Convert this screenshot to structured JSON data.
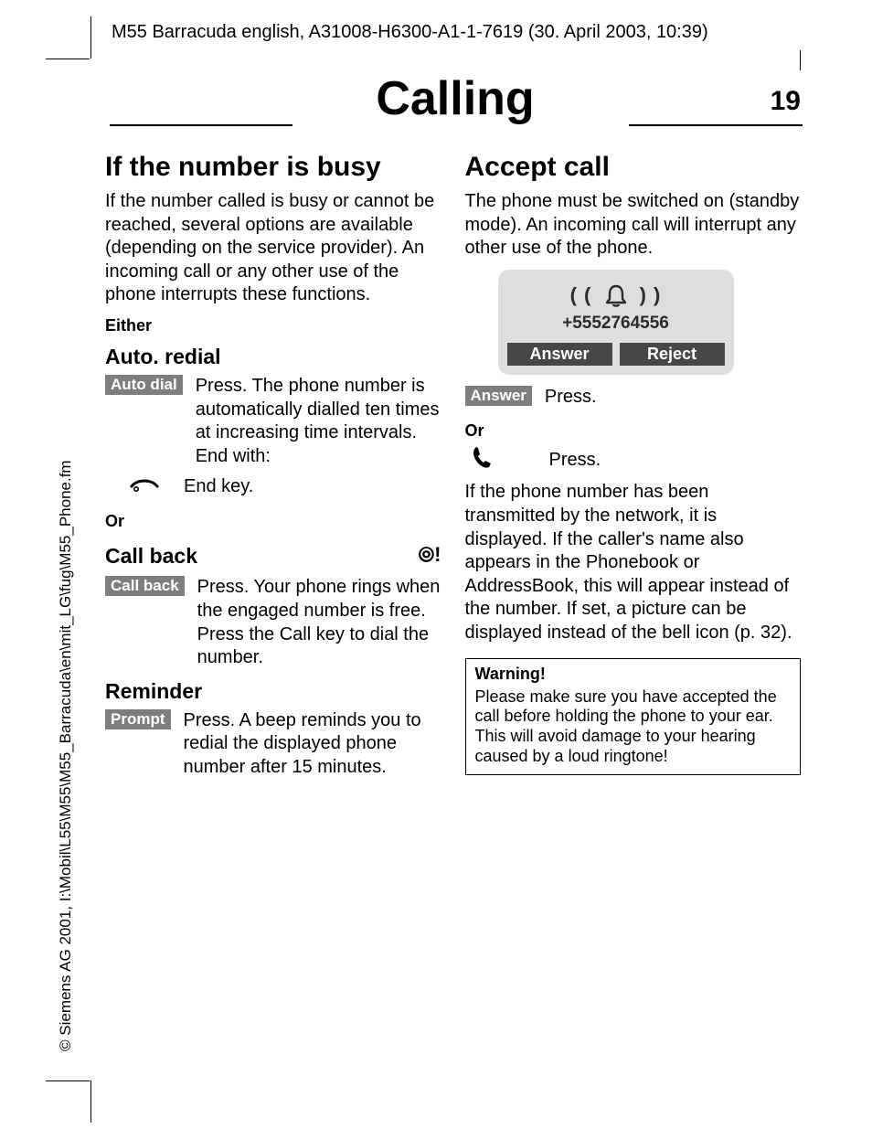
{
  "running_head": "M55 Barracuda english, A31008-H6300-A1-1-7619 (30. April 2003, 10:39)",
  "chapter_title": "Calling",
  "page_number": "19",
  "side_copyright": "© Siemens AG 2001, I:\\Mobil\\L55\\M55\\M55_Barracuda\\en\\mit_LG\\fug\\M55_Phone.fm",
  "left": {
    "h2": "If the number is busy",
    "intro": "If the number called is busy or cannot be reached, several options are available (depending on the service provider). An incoming call or any other use of the phone interrupts these functions.",
    "either": "Either",
    "auto_redial": {
      "heading": "Auto. redial",
      "badge": "Auto dial",
      "text": "Press. The phone number is automatically dialled ten times at increasing time intervals. End with:",
      "endkey": "End key."
    },
    "or1": "Or",
    "call_back": {
      "heading": "Call back",
      "svc_icon": "⦾!",
      "badge": "Call back",
      "text": "Press. Your phone rings when the engaged number is free. Press the Call key to dial the number."
    },
    "reminder": {
      "heading": "Reminder",
      "badge": "Prompt",
      "text": "Press. A beep reminds you to redial the displayed phone number after 15 minutes."
    }
  },
  "right": {
    "h2": "Accept call",
    "intro": "The phone must be switched on (standby mode). An incoming call will interrupt any other use of the phone.",
    "incoming_number": "+5552764556",
    "softkey_left": "Answer",
    "softkey_right": "Reject",
    "answer": {
      "badge": "Answer",
      "text": "Press."
    },
    "or": "Or",
    "callkey_text": "Press.",
    "para": "If the phone number has been transmitted by the network, it is displayed. If the caller's name also appears in the Phonebook or AddressBook, this will appear instead of the number. If set, a picture can be displayed instead of the bell icon (p. 32).",
    "warning": {
      "title": "Warning!",
      "body": "Please make sure you have accepted the call before holding the phone to your ear. This will avoid damage to your hearing caused by a loud ringtone!"
    }
  }
}
